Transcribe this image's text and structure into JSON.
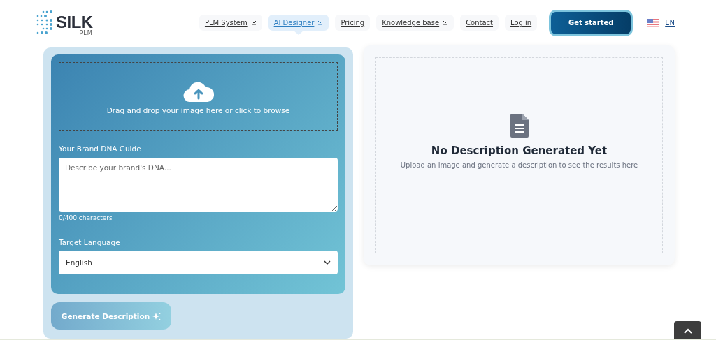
{
  "header": {
    "logo": {
      "name": "SILK",
      "sub": "PLM"
    },
    "nav": [
      {
        "label": "PLM System",
        "dropdown": true,
        "selected": false
      },
      {
        "label": "AI Designer",
        "dropdown": true,
        "selected": true
      },
      {
        "label": "Pricing",
        "dropdown": false,
        "selected": false
      },
      {
        "label": "Knowledge base",
        "dropdown": true,
        "selected": false
      },
      {
        "label": "Contact",
        "dropdown": false,
        "selected": false
      },
      {
        "label": "Log in",
        "dropdown": false,
        "selected": false
      }
    ],
    "cta": "Get started",
    "language": "EN"
  },
  "form": {
    "dropzone": "Drag and drop your image here or click to browse",
    "brand_label": "Your Brand DNA Guide",
    "brand_placeholder": "Describe your brand's DNA...",
    "counter": "0/400 characters",
    "language_label": "Target Language",
    "language_value": "English",
    "generate_button": "Generate Description",
    "generate_disabled": true
  },
  "result": {
    "title": "No Description Generated Yet",
    "message": "Upload an image and generate a description to see the results here"
  }
}
